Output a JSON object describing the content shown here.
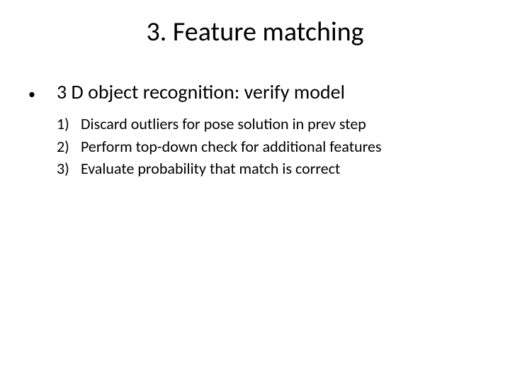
{
  "title": "3. Feature matching",
  "bullet": {
    "marker": "•",
    "text": "3 D object recognition: verify model"
  },
  "steps": [
    {
      "label": "1)",
      "text": "Discard outliers for pose solution in prev step"
    },
    {
      "label": "2)",
      "text": "Perform top-down check for additional features"
    },
    {
      "label": "3)",
      "text": "Evaluate probability that match is correct"
    }
  ]
}
